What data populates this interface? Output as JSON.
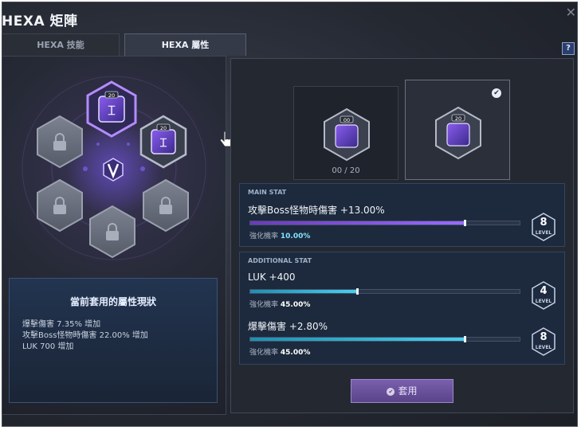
{
  "window": {
    "title": "HEXA 矩陣",
    "close_glyph": "✕",
    "help_glyph": "?"
  },
  "tabs": [
    {
      "label": "HEXA 技能",
      "active": false
    },
    {
      "label": "HEXA 屬性",
      "active": true
    }
  ],
  "hex_grid": {
    "center_icon": "v-emblem-icon",
    "nodes": [
      {
        "position": "top",
        "state": "unlocked",
        "level_badge": "20",
        "icon": "stat-core-icon"
      },
      {
        "position": "upper-right",
        "state": "unlocked",
        "level_badge": "20",
        "icon": "stat-core-icon"
      },
      {
        "position": "upper-left",
        "state": "locked",
        "icon": "lock-icon"
      },
      {
        "position": "lower-left",
        "state": "locked",
        "icon": "lock-icon"
      },
      {
        "position": "lower-right",
        "state": "locked",
        "icon": "lock-icon"
      },
      {
        "position": "bottom",
        "state": "locked",
        "icon": "lock-icon"
      }
    ]
  },
  "current_stats": {
    "title": "當前套用的屬性現狀",
    "lines": [
      "爆擊傷害 7.35% 增加",
      "攻擊Boss怪物時傷害 22.00% 增加",
      "LUK 700 增加"
    ]
  },
  "slots": {
    "left": {
      "badge": "00",
      "count_text": "00 / 20"
    },
    "right": {
      "badge": "20",
      "selected_glyph": "✔"
    }
  },
  "main_stat": {
    "header": "MAIN STAT",
    "text": "攻擊Boss怪物時傷害 +13.00%",
    "prob_label": "強化機率",
    "prob_value": "10.00%",
    "level": "8",
    "level_label": "LEVEL",
    "progress": 0.8
  },
  "additional_stat": {
    "header": "ADDITIONAL STAT",
    "items": [
      {
        "text": "LUK +400",
        "prob_label": "強化機率",
        "prob_value": "45.00%",
        "level": "4",
        "level_label": "LEVEL",
        "progress": 0.4
      },
      {
        "text": "爆擊傷害 +2.80%",
        "prob_label": "強化機率",
        "prob_value": "45.00%",
        "level": "8",
        "level_label": "LEVEL",
        "progress": 0.8
      }
    ]
  },
  "apply_button": {
    "label": "套用",
    "icon": "check-circle-icon"
  },
  "colors": {
    "accent_purple": "#8a5cf0",
    "accent_cyan": "#49d0ee",
    "panel_bg": "#242831"
  }
}
